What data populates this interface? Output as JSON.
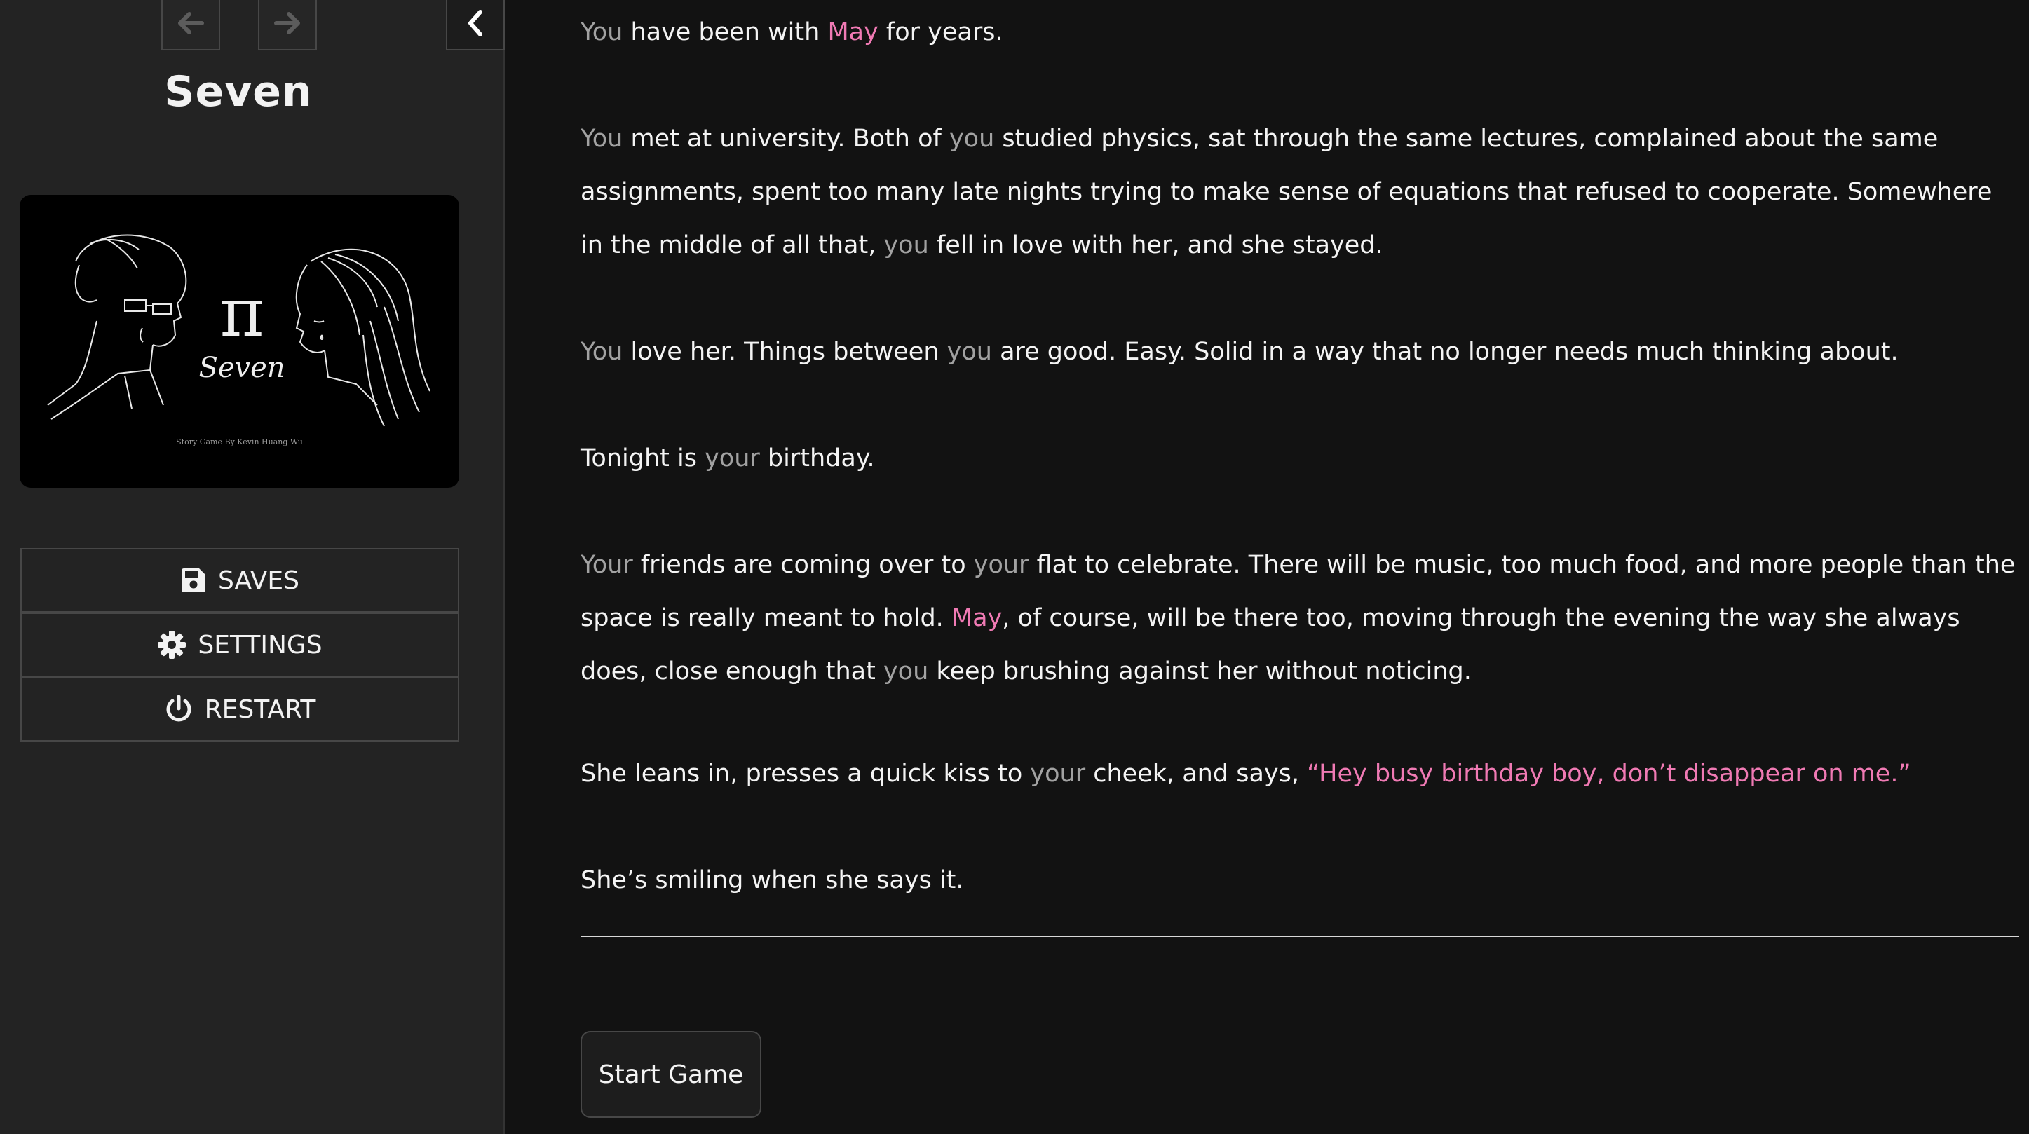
{
  "sidebar": {
    "title": "Seven",
    "cover": {
      "symbol": "π",
      "logo_text": "Seven",
      "credit": "Story Game By Kevin Huang Wu"
    },
    "menu": [
      {
        "label": "SAVES",
        "icon": "save-icon"
      },
      {
        "label": "SETTINGS",
        "icon": "gear-icon"
      },
      {
        "label": "RESTART",
        "icon": "power-icon"
      }
    ]
  },
  "passage": {
    "p1": {
      "s1": "You",
      "s2": " have been with ",
      "s3": "May",
      "s4": " for years."
    },
    "p2": {
      "s1": "You",
      "s2": " met at university. Both of ",
      "s3": "you",
      "s4": " studied physics, sat through the same lectures, complained about the same assignments, spent too many late nights trying to make sense of equations that refused to cooperate. Somewhere in the middle of all that, ",
      "s5": "you",
      "s6": " fell in love with her, and she stayed."
    },
    "p3": {
      "s1": "You",
      "s2": " love her. Things between ",
      "s3": "you",
      "s4": " are good. Easy. Solid in a way that no longer needs much thinking about."
    },
    "p4": {
      "s1": "Tonight is ",
      "s2": "your",
      "s3": " birthday."
    },
    "p5": {
      "s1": "Your",
      "s2": " friends are coming over to ",
      "s3": "your",
      "s4": " flat to celebrate. There will be music, too much food, and more people than the space is really meant to hold. ",
      "s5": "May",
      "s6": ", of course, will be there too, moving through the evening the way she always does, close enough that ",
      "s7": "you",
      "s8": " keep brushing against her without noticing."
    },
    "p6": {
      "s1": "She leans in, presses a quick kiss to ",
      "s2": "your",
      "s3": " cheek, and says, ",
      "s4": "“Hey busy birthday boy, don’t disappear on me.”"
    },
    "p7": {
      "s1": "She’s smiling when she says it."
    }
  },
  "actions": {
    "start_label": "Start Game"
  },
  "colors": {
    "background": "#121212",
    "sidebar": "#232323",
    "text": "#f4f4f4",
    "pronoun_highlight": "#a2a2a2",
    "may_highlight": "#f07ab4"
  }
}
